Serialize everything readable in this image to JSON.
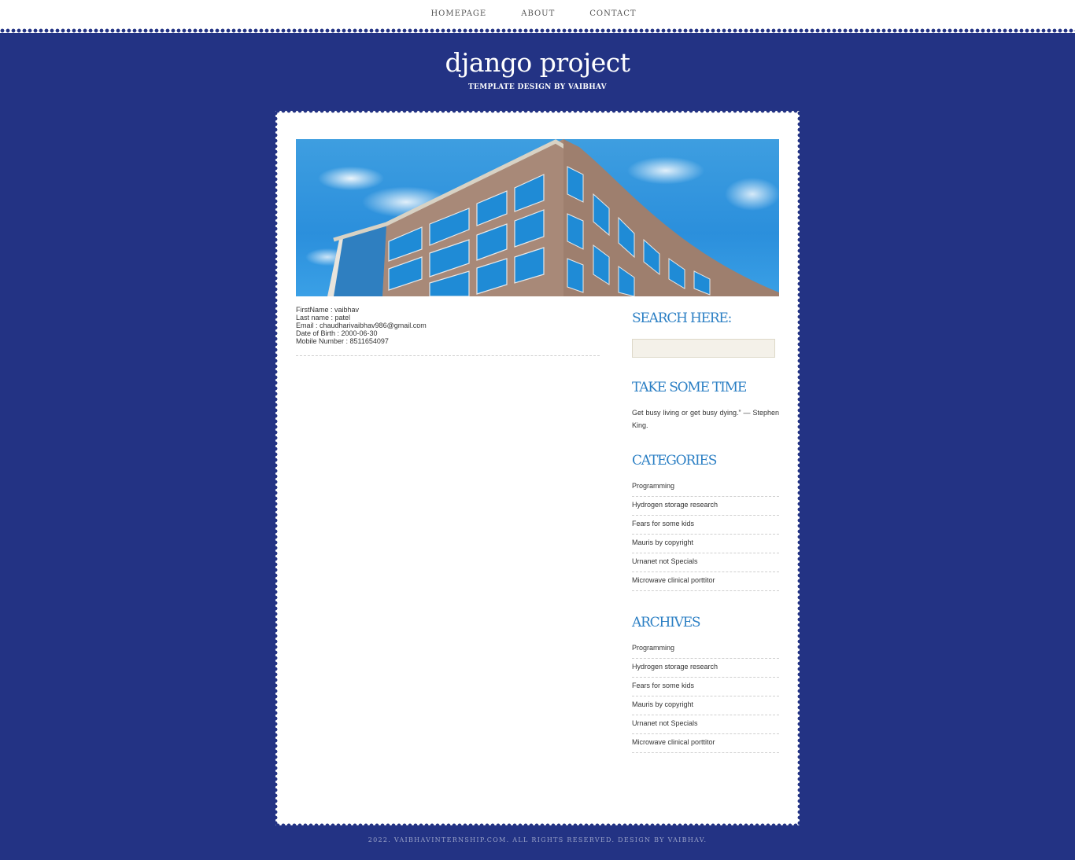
{
  "nav": {
    "items": [
      "HOMEPAGE",
      "ABOUT",
      "CONTACT"
    ]
  },
  "site": {
    "title": "django project",
    "subtitle": "TEMPLATE DESIGN BY VAIBHAV"
  },
  "hero": {
    "image": "office-building-photo"
  },
  "profile": {
    "first_name": "FirstName : vaibhav",
    "last_name": "Last name : patel",
    "email": "Email : chaudharivaibhav986@gmail.com",
    "dob": "Date of Birth : 2000-06-30",
    "mobile": "Mobile Number : 8511654097"
  },
  "sidebar": {
    "search_title": "SEARCH HERE:",
    "search_value": "",
    "quote_title": "TAKE SOME TIME",
    "quote_text": "Get busy living or get busy dying.” — Stephen King.",
    "categories_title": "CATEGORIES",
    "categories": [
      "Programming",
      "Hydrogen storage research",
      "Fears for some kids",
      "Mauris by copyright",
      "Urnanet not Specials",
      "Microwave clinical porttitor"
    ],
    "archives_title": "ARCHIVES",
    "archives": [
      "Programming",
      "Hydrogen storage research",
      "Fears for some kids",
      "Mauris by copyright",
      "Urnanet not Specials",
      "Microwave clinical porttitor"
    ]
  },
  "footer": {
    "text": "2022. VAIBHAVINTERNSHIP.COM. ALL RIGHTS RESERVED. DESIGN BY",
    "link": "VAIBHAV",
    "end": "."
  },
  "colors": {
    "background": "#233384",
    "accent": "#2b7fc4",
    "card": "#ffffff"
  }
}
